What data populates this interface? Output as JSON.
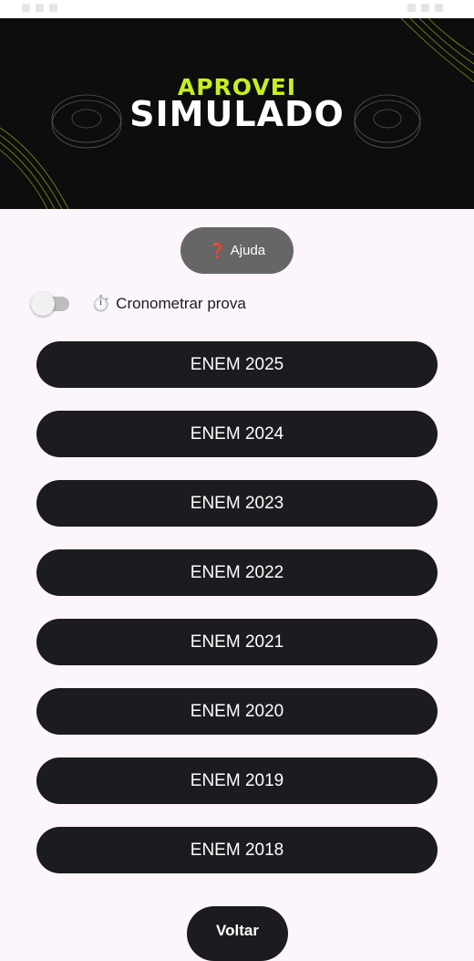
{
  "banner": {
    "title_line1": "APROVEI",
    "title_line2": "SIMULADO",
    "accent_color": "#c6f01e"
  },
  "help_button": {
    "icon": "question-mark-icon",
    "icon_glyph": "❓",
    "label": "Ajuda"
  },
  "timer": {
    "enabled": false,
    "icon": "stopwatch-icon",
    "icon_glyph": "⏱️",
    "label": "Cronometrar prova"
  },
  "exams": [
    {
      "label": "ENEM 2025"
    },
    {
      "label": "ENEM 2024"
    },
    {
      "label": "ENEM 2023"
    },
    {
      "label": "ENEM 2022"
    },
    {
      "label": "ENEM 2021"
    },
    {
      "label": "ENEM 2020"
    },
    {
      "label": "ENEM 2019"
    },
    {
      "label": "ENEM 2018"
    }
  ],
  "back_button": {
    "label": "Voltar"
  },
  "colors": {
    "background": "#fcf5fb",
    "button_dark": "#1c1b20",
    "help_button": "#666666"
  }
}
